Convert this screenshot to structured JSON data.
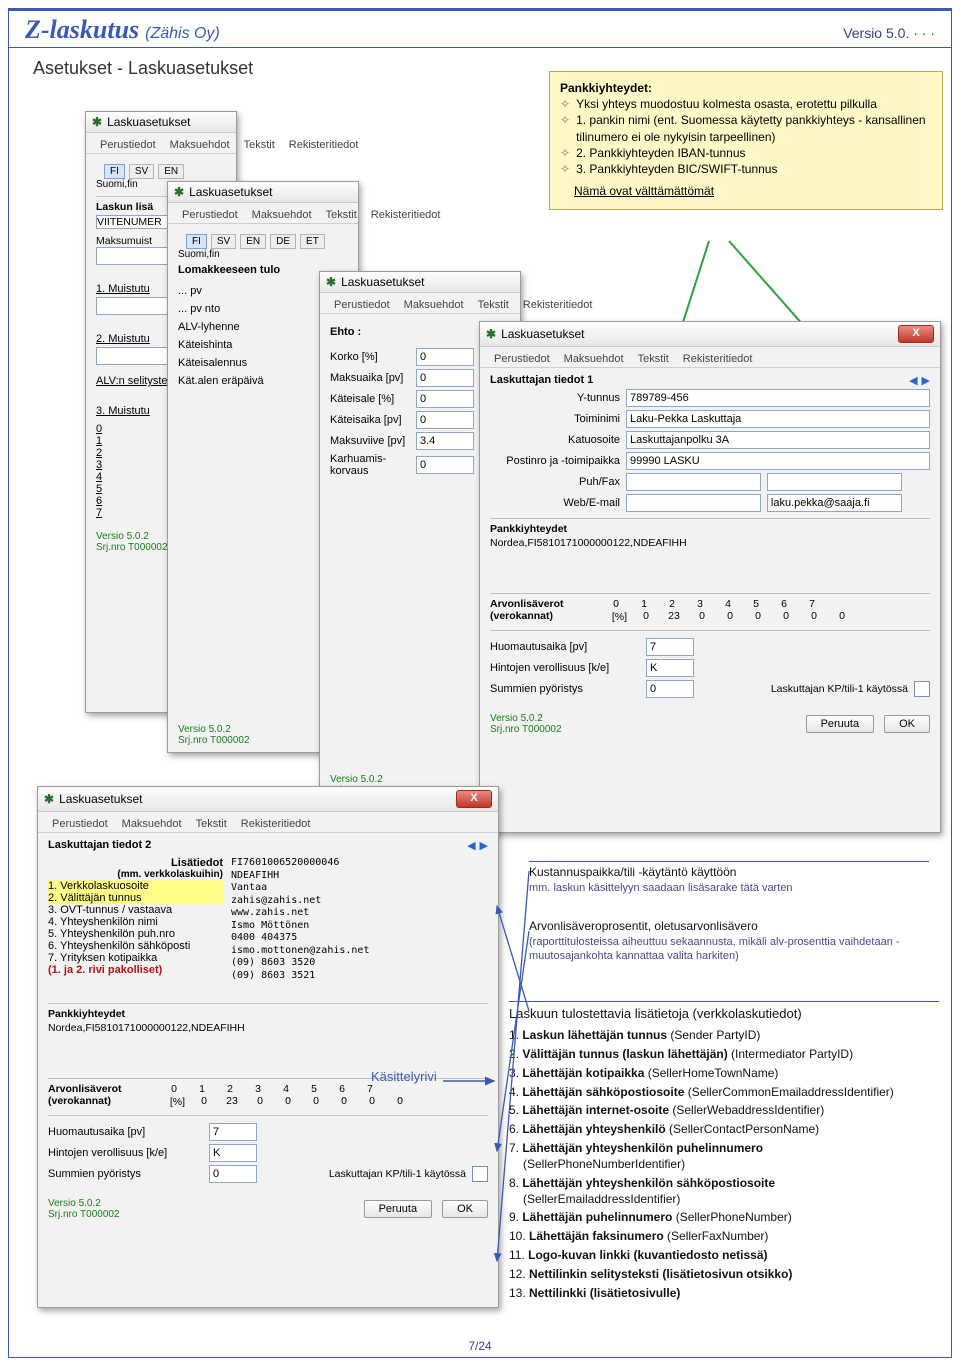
{
  "header": {
    "brand": "Z-laskutus",
    "brand_sub": "(Zähis Oy)",
    "version": "Versio 5.0. · · ·"
  },
  "section_title": "Asetukset - Laskuasetukset",
  "callout": {
    "title": "Pankkiyhteydet:",
    "line0": "Yksi yhteys muodostuu kolmesta osasta, erotettu pilkulla",
    "line1": "1. pankin nimi (ent. Suomessa käytetty pankkiyhteys - kansallinen tilinumero ei ole nykyisin tarpeellinen)",
    "line2": "2. Pankkiyhteyden IBAN-tunnus",
    "line3": "3. Pankkiyhteyden BIC/SWIFT-tunnus",
    "mandatory": "Nämä ovat välttämättömät"
  },
  "dlg_common": {
    "title": "Laskuasetukset",
    "tabs": [
      "Perustiedot",
      "Maksuehdot",
      "Tekstit",
      "Rekisteritiedot"
    ],
    "ver": "Versio 5.0.2",
    "srj": "Srj.nro T000002",
    "peruuta": "Peruuta",
    "ok": "OK",
    "close": "X"
  },
  "dlg1": {
    "langs": [
      "FI",
      "SV",
      "EN"
    ],
    "sublabel": "Suomi,fin",
    "grp1": "Laskun lisä",
    "row_viite": "VIITENUMER",
    "row_maksumuist": "Maksumuist",
    "muistu1": "1. Muistutu",
    "muistu2": "2. Muistutu",
    "alv": "ALV:n selitystekstit",
    "muistu3": "3. Muistutu",
    "nums": [
      "0",
      "1",
      "2",
      "3",
      "4",
      "5",
      "6",
      "7"
    ]
  },
  "dlg2": {
    "langs": [
      "FI",
      "SV",
      "EN",
      "DE",
      "ET"
    ],
    "sublabel": "Suomi,fin",
    "grp": "Lomakkeeseen tulo",
    "items": [
      "... pv",
      "... pv nto",
      "ALV-lyhenne",
      "Käteishinta",
      "Käteisalennus",
      "Kät.alen eräpäivä"
    ]
  },
  "dlg3": {
    "ehto": "Ehto :",
    "rows": [
      {
        "label": "Korko [%]",
        "val": "0"
      },
      {
        "label": "Maksuaika [pv]",
        "val": "0"
      },
      {
        "label": "Käteisale [%]",
        "val": "0"
      },
      {
        "label": "Käteisaika [pv]",
        "val": "0"
      },
      {
        "label": "Maksuviive [pv]",
        "val": "3.4"
      },
      {
        "label": "Karhuamis-korvaus",
        "val": "0"
      }
    ]
  },
  "dlg4": {
    "grp1": "Laskuttajan tiedot 1",
    "ytunnus_l": "Y-tunnus",
    "ytunnus": "789789-456",
    "toiminimi_l": "Toiminimi",
    "toiminimi": "Laku-Pekka Laskuttaja",
    "katu_l": "Katuosoite",
    "katu": "Laskuttajanpolku 3A",
    "posti_l": "Postinro ja -toimipaikka",
    "posti": "99990 LASKU",
    "puh_l": "Puh/Fax",
    "web_l": "Web/E-mail",
    "email": "laku.pekka@saaja.fi",
    "pank_grp": "Pankkiyhteydet",
    "pank_val": "Nordea,FI5810171000000122,NDEAFIHH",
    "alv_grp": "Arvonlisäverot (verokannat)",
    "alv_idx": [
      "0",
      "1",
      "2",
      "3",
      "4",
      "5",
      "6",
      "7"
    ],
    "alv_pct_label": "[%]",
    "alv_vals": [
      "0",
      "23",
      "0",
      "0",
      "0",
      "0",
      "0",
      "0"
    ],
    "huom_l": "Huomautusaika [pv]",
    "huom": "7",
    "hinta_l": "Hintojen verollisuus [k/e]",
    "hinta": "K",
    "sum_l": "Summien pyöristys",
    "sum": "0",
    "kp_l": "Laskuttajan KP/tili-1 käytössä"
  },
  "dlg5": {
    "grp1": "Laskuttajan tiedot 2",
    "lisa_label": "Lisätiedot",
    "lisa_sub": "(mm. verkkolaskuihin)",
    "list": [
      "1. Verkkolaskuosoite",
      "2. Välittäjän tunnus",
      "3. OVT-tunnus / vastaava",
      "4. Yhteyshenkilön nimi",
      "5. Yhteyshenkilön puh.nro",
      "6. Yhteyshenkilön sähköposti",
      "7. Yrityksen kotipaikka"
    ],
    "list_mand": "(1. ja 2. rivi pakolliset)",
    "text_lines": [
      "FI7601006520000046",
      "NDEAFIHH",
      "Vantaa",
      "zahis@zahis.net",
      "www.zahis.net",
      "Ismo Möttönen",
      "0400 404375",
      "ismo.mottonen@zahis.net",
      "(09) 8603 3520",
      "(09) 8603 3521"
    ],
    "pank_grp": "Pankkiyhteydet",
    "pank_val": "Nordea,FI5810171000000122,NDEAFIHH",
    "alv_grp": "Arvonlisäverot (verokannat)",
    "alv_idx": [
      "0",
      "1",
      "2",
      "3",
      "4",
      "5",
      "6",
      "7"
    ],
    "alv_pct_label": "[%]",
    "alv_vals": [
      "0",
      "23",
      "0",
      "0",
      "0",
      "0",
      "0",
      "0"
    ],
    "huom_l": "Huomautusaika [pv]",
    "huom": "7",
    "hinta_l": "Hintojen verollisuus [k/e]",
    "hinta": "K",
    "sum_l": "Summien pyöristys",
    "sum": "0",
    "kp_l": "Laskuttajan KP/tili-1 käytössä"
  },
  "handle_label": "Käsittelyrivi",
  "anno1": {
    "line1": "Kustannuspaikka/tili -käytäntö käyttöön",
    "line2": "mm. laskun käsittelyyn saadaan lisäsarake tätä varten"
  },
  "anno2": {
    "line1": "Arvonlisäveroprosentit, oletusarvonlisävero",
    "line2": "(raporttitulosteissa aiheuttuu sekaannusta, mikäli alv-prosenttia vaihdetaan - muutosajankohta kannattaa valita harkiten)"
  },
  "anno3": {
    "title": "Laskuun tulostettavia lisätietoja (verkkolaskutiedot)",
    "items": [
      {
        "n": "1.",
        "b": "Laskun lähettäjän tunnus",
        "p": "(Sender PartyID)"
      },
      {
        "n": "2.",
        "b": "Välittäjän tunnus (laskun lähettäjän)",
        "p": "(Intermediator PartyID)"
      },
      {
        "n": "3.",
        "b": "Lähettäjän kotipaikka",
        "p": "(SellerHomeTownName)"
      },
      {
        "n": "4.",
        "b": "Lähettäjän sähköpostiosoite",
        "p": "(SellerCommonEmailaddressIdentifier)"
      },
      {
        "n": "5.",
        "b": "Lähettäjän internet-osoite",
        "p": "(SellerWebaddressIdentifier)"
      },
      {
        "n": "6.",
        "b": "Lähettäjän yhteyshenkilö",
        "p": "(SellerContactPersonName)"
      },
      {
        "n": "7.",
        "b": "Lähettäjän yhteyshenkilön puhelinnumero",
        "p": "(SellerPhoneNumberIdentifier)"
      },
      {
        "n": "8.",
        "b": "Lähettäjän yhteyshenkilön sähköpostiosoite",
        "p": "(SellerEmailaddressIdentifier)"
      },
      {
        "n": "9.",
        "b": "Lähettäjän puhelinnumero",
        "p": "(SellerPhoneNumber)"
      },
      {
        "n": "10.",
        "b": "Lähettäjän faksinumero",
        "p": "(SellerFaxNumber)"
      },
      {
        "n": "11.",
        "b": "Logo-kuvan linkki (kuvantiedosto netissä)",
        "p": ""
      },
      {
        "n": "12.",
        "b": "Nettilinkin selitysteksti (lisätietosivun otsikko)",
        "p": ""
      },
      {
        "n": "13.",
        "b": "Nettilinkki (lisätietosivulle)",
        "p": ""
      }
    ]
  },
  "page_num": "7/24"
}
